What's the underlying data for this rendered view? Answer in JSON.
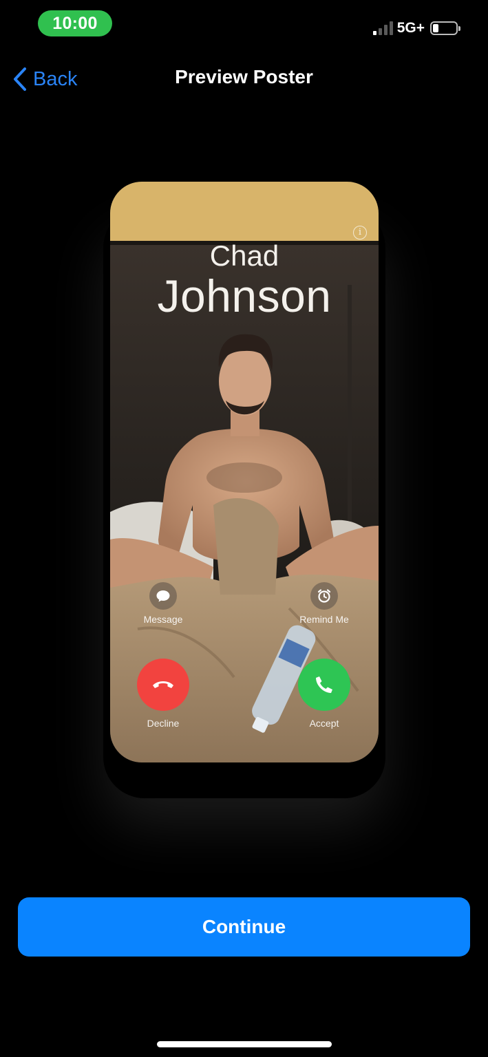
{
  "status_bar": {
    "time": "10:00",
    "network": "5G+",
    "signal_bars_filled": 1,
    "signal_bars_total": 4,
    "battery_level": 0.2
  },
  "nav": {
    "back_label": "Back",
    "title": "Preview Poster"
  },
  "poster": {
    "first_name": "Chad",
    "last_name": "Johnson",
    "actions": {
      "message_label": "Message",
      "remind_label": "Remind Me",
      "decline_label": "Decline",
      "accept_label": "Accept"
    },
    "colors": {
      "decline": "#f2433f",
      "accept": "#2ec554"
    }
  },
  "continue_label": "Continue",
  "colors": {
    "accent": "#0a84ff",
    "time_pill": "#30c04f"
  }
}
